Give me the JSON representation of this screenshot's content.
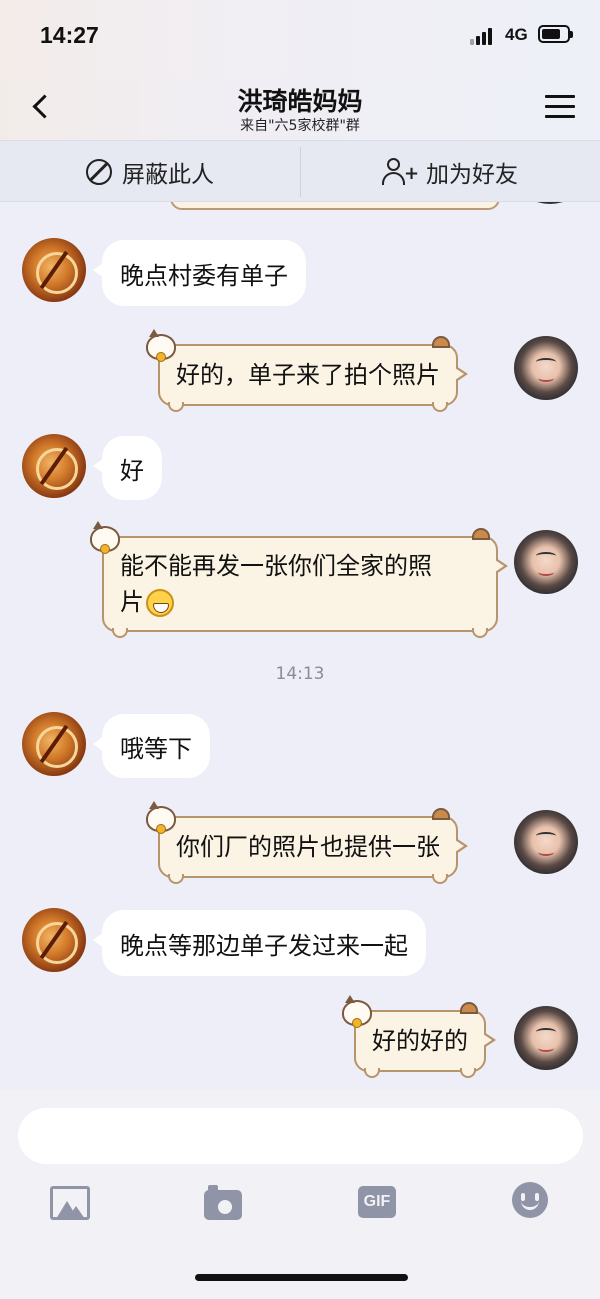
{
  "status_bar": {
    "time": "14:27",
    "network": "4G"
  },
  "header": {
    "back_icon": "chevron-left-icon",
    "title": "洪琦皓妈妈",
    "subtitle": "来自\"六5家校群\"群",
    "menu_icon": "hamburger-menu-icon"
  },
  "actions": {
    "block_label": "屏蔽此人",
    "add_friend_label": "加为好友"
  },
  "messages": [
    {
      "sender": "them",
      "text": "晚点村委有单子"
    },
    {
      "sender": "me",
      "text": "好的，单子来了拍个照片"
    },
    {
      "sender": "them",
      "text": "好"
    },
    {
      "sender": "me",
      "line1": "能不能再发一张你们全家的照",
      "line2": "片",
      "emoji": "grinning-face"
    },
    {
      "sender": "them",
      "text": "哦等下"
    },
    {
      "sender": "me",
      "text": "你们厂的照片也提供一张"
    },
    {
      "sender": "them",
      "text": "晚点等那边单子发过来一起"
    },
    {
      "sender": "me",
      "text": "好的好的"
    }
  ],
  "timestamp": "14:13",
  "input": {
    "value": "",
    "toolbar": [
      "image-icon",
      "camera-icon",
      "gif-icon",
      "emoji-icon"
    ],
    "gif_label": "GIF"
  },
  "colors": {
    "background": "#edeef7",
    "bubble_them": "#ffffff",
    "bubble_me": "#fbf3e4",
    "bubble_me_border": "#b8946c"
  }
}
